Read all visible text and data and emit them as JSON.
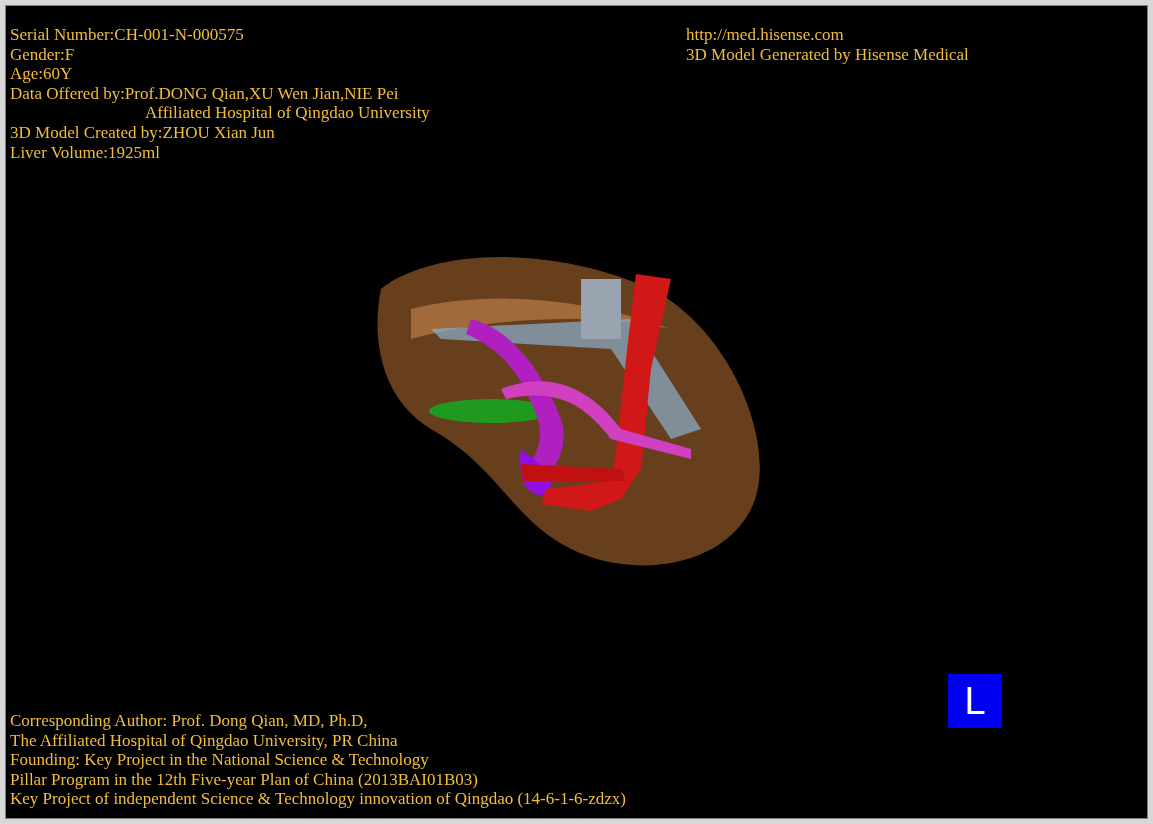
{
  "info_top_left": [
    {
      "kind": "line",
      "text": "Serial Number:CH-001-N-000575"
    },
    {
      "kind": "line",
      "text": "Gender:F"
    },
    {
      "kind": "line",
      "text": "Age:60Y"
    },
    {
      "kind": "line",
      "text": "Data Offered by:Prof.DONG Qian,XU Wen Jian,NIE Pei"
    },
    {
      "kind": "continuation",
      "text": "Affiliated Hospital of Qingdao University"
    },
    {
      "kind": "line",
      "text": "3D Model Created by:ZHOU Xian Jun"
    },
    {
      "kind": "line",
      "text": "Liver Volume:1925ml"
    }
  ],
  "info_top_right": [
    "http://med.hisense.com",
    "3D Model Generated by Hisense Medical"
  ],
  "orientation_marker": "L",
  "info_bottom": [
    "Corresponding Author: Prof. Dong Qian, MD, Ph.D,",
    "The Affiliated Hospital of Qingdao University, PR China",
    "Founding: Key Project in the National Science & Technology",
    "Pillar Program in the 12th Five-year Plan of China (2013BAI01B03)",
    "Key Project of independent Science & Technology innovation of Qingdao (14-6-1-6-zdzx)"
  ]
}
